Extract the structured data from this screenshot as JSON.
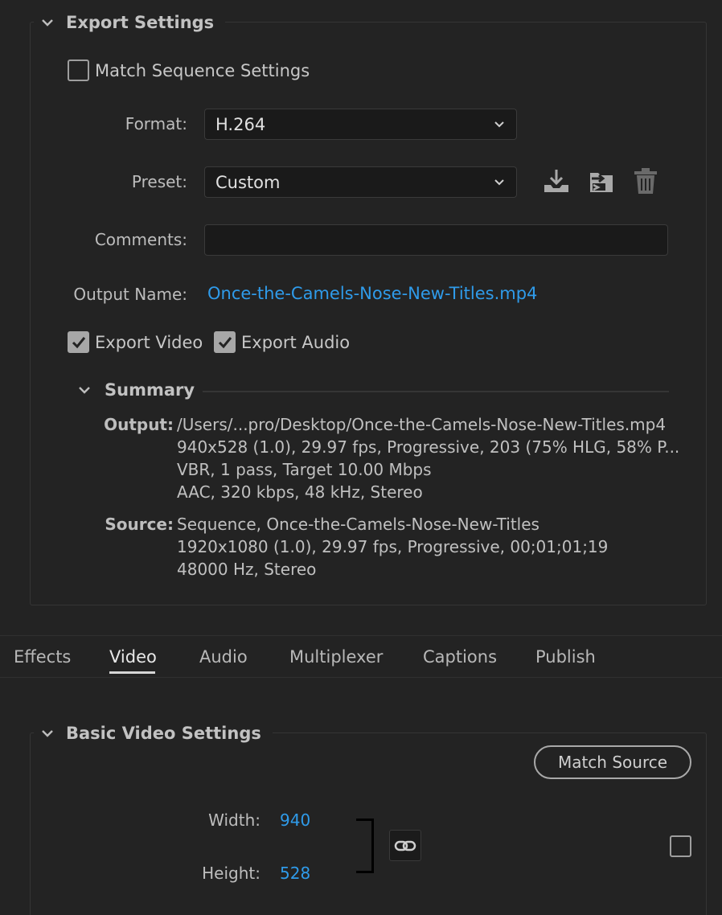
{
  "export_settings": {
    "title": "Export Settings",
    "match_sequence": {
      "label": "Match Sequence Settings",
      "checked": false
    },
    "format": {
      "label": "Format:",
      "value": "H.264"
    },
    "preset": {
      "label": "Preset:",
      "value": "Custom"
    },
    "comments": {
      "label": "Comments:",
      "value": ""
    },
    "output_name": {
      "label": "Output Name:",
      "value": "Once-the-Camels-Nose-New-Titles.mp4"
    },
    "export_video": {
      "label": "Export Video",
      "checked": true
    },
    "export_audio": {
      "label": "Export Audio",
      "checked": true
    },
    "summary": {
      "title": "Summary",
      "output_key": "Output:",
      "output_lines": [
        "/Users/...pro/Desktop/Once-the-Camels-Nose-New-Titles.mp4",
        "940x528 (1.0), 29.97 fps, Progressive, 203 (75% HLG, 58% P...",
        "VBR, 1 pass, Target 10.00 Mbps",
        "AAC, 320 kbps, 48 kHz, Stereo"
      ],
      "source_key": "Source:",
      "source_lines": [
        "Sequence, Once-the-Camels-Nose-New-Titles",
        "1920x1080 (1.0), 29.97 fps, Progressive, 00;01;01;19",
        "48000 Hz, Stereo"
      ]
    }
  },
  "tabs": [
    {
      "label": "Effects",
      "active": false
    },
    {
      "label": "Video",
      "active": true
    },
    {
      "label": "Audio",
      "active": false
    },
    {
      "label": "Multiplexer",
      "active": false
    },
    {
      "label": "Captions",
      "active": false
    },
    {
      "label": "Publish",
      "active": false
    }
  ],
  "basic_video": {
    "title": "Basic Video Settings",
    "match_source_label": "Match Source",
    "width": {
      "label": "Width:",
      "value": "940"
    },
    "height": {
      "label": "Height:",
      "value": "528"
    }
  },
  "icons": [
    "chevron-down-icon",
    "save-preset-icon",
    "import-preset-icon",
    "trash-icon",
    "link-icon",
    "checkmark-icon"
  ],
  "colors": {
    "background": "#232323",
    "accent_blue": "#2f9bea",
    "text": "#c7c7c7"
  }
}
